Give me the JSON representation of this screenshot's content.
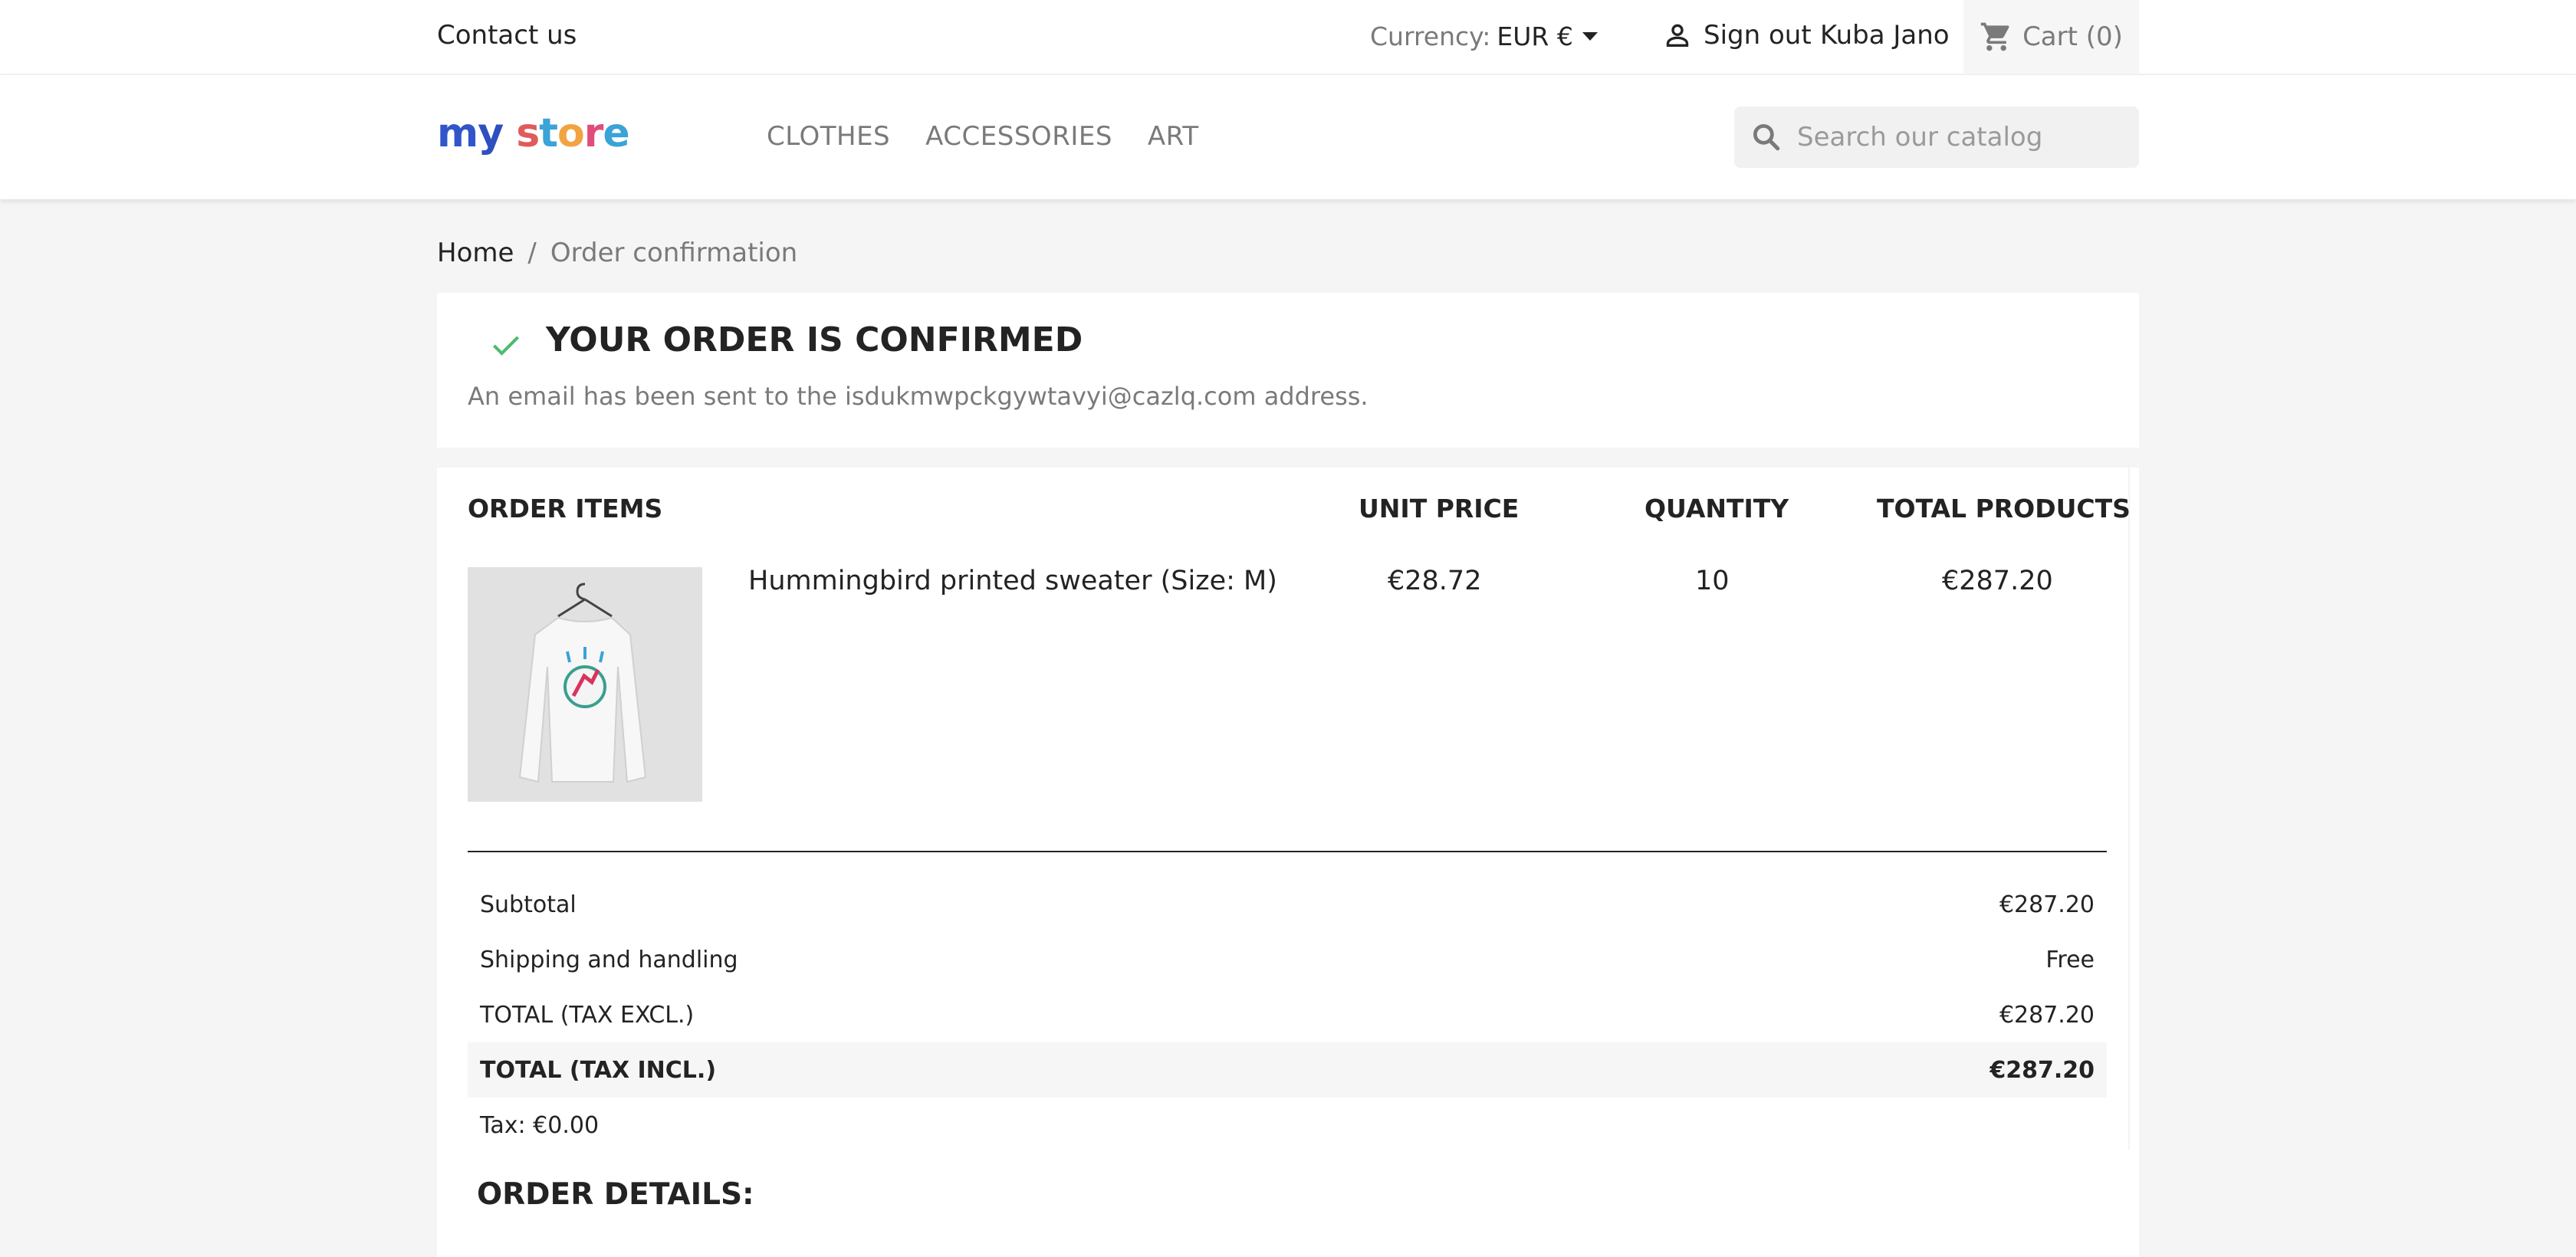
{
  "topbar": {
    "contact": "Contact us",
    "currency_label": "Currency:",
    "currency_value": "EUR €",
    "signout": "Sign out",
    "username": "Kuba Jano",
    "cart": "Cart (0)"
  },
  "header": {
    "logo": {
      "letters": [
        {
          "ch": "m",
          "color": "#3056c9"
        },
        {
          "ch": "y",
          "color": "#2e4fbf"
        },
        {
          "ch": " ",
          "color": "#ffffff"
        },
        {
          "ch": "s",
          "color": "#e05b5b"
        },
        {
          "ch": "t",
          "color": "#3aa3d8"
        },
        {
          "ch": "o",
          "color": "#f2a341"
        },
        {
          "ch": "r",
          "color": "#e04d7a"
        },
        {
          "ch": "e",
          "color": "#3aa3d8"
        }
      ]
    },
    "nav": [
      "CLOTHES",
      "ACCESSORIES",
      "ART"
    ],
    "search_placeholder": "Search our catalog"
  },
  "breadcrumb": {
    "home": "Home",
    "separator": "/",
    "current": "Order confirmation"
  },
  "confirmation": {
    "title": "YOUR ORDER IS CONFIRMED",
    "email_text": "An email has been sent to the isdukmwpckgywtavyi@cazlq.com address.",
    "check_color": "#4cbb6c"
  },
  "order": {
    "headers": {
      "items": "ORDER ITEMS",
      "unit_price": "UNIT PRICE",
      "quantity": "QUANTITY",
      "total_products": "TOTAL PRODUCTS"
    },
    "items": [
      {
        "image": "sweater-image",
        "name": "Hummingbird printed sweater (Size: M)",
        "unit_price": "€28.72",
        "quantity": "10",
        "total": "€287.20"
      }
    ],
    "totals": {
      "subtotal_label": "Subtotal",
      "subtotal_value": "€287.20",
      "shipping_label": "Shipping and handling",
      "shipping_value": "Free",
      "excl_label": "TOTAL (TAX EXCL.)",
      "excl_value": "€287.20",
      "incl_label": "TOTAL (TAX INCL.)",
      "incl_value": "€287.20",
      "tax_label": "Tax: €0.00"
    },
    "details_title": "ORDER DETAILS:"
  }
}
